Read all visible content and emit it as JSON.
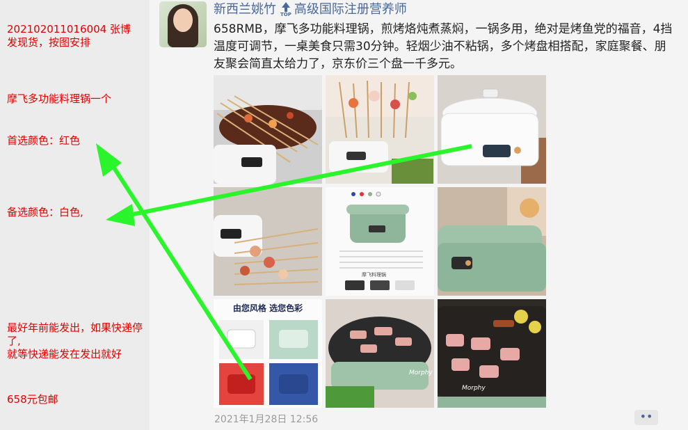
{
  "notes": {
    "order": "202102011016004   张博\n发现货，按图安排",
    "item": "摩飞多功能料理锅一个",
    "first_color": "首选颜色：红色",
    "alt_color": "备选颜色：白色,",
    "shipping": "最好年前能发出，如果快递停了,\n就等快递能发在发出就好",
    "price": "658元包邮"
  },
  "post": {
    "author": "新西兰姚竹",
    "top_badge": "TOP",
    "author_title": "高级国际注册营养师",
    "text": "658RMB，摩飞多功能料理锅，煎烤烙炖煮蒸焖，一锅多用，绝对是烤鱼党的福音，4挡温度可调节，一桌美食只需30分钟。轻烟少油不粘锅，多个烤盘相搭配，家庭聚餐、朋友聚会简直太给力了，京东价三个盘一千多元。",
    "timestamp": "2021年1月28日 12:56",
    "more_label": "••"
  },
  "images": {
    "banner_text": "由您风格 选您色彩",
    "plate_label": "摩飞料理锅",
    "brand": "Morphy"
  },
  "colors": {
    "note_red": "#e00000",
    "arrow_green": "#2af52a",
    "link_blue": "#4a6799"
  }
}
